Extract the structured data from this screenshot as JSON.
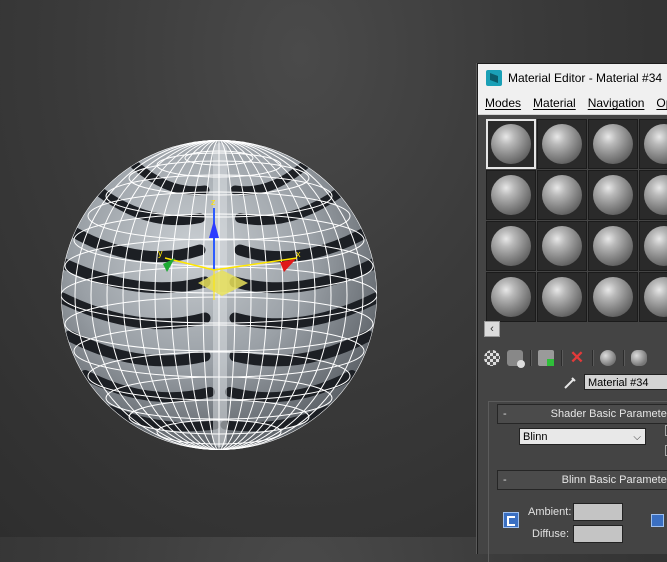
{
  "viewport": {
    "gizmo_axes": {
      "x_label": "x",
      "y_label": "y",
      "z_label": "z"
    }
  },
  "material_editor": {
    "title": "Material Editor - Material #34",
    "menu": [
      "Modes",
      "Material",
      "Navigation",
      "Options"
    ],
    "slots_visible": 16,
    "scroll_left_icon": "‹",
    "toolbar_icons": [
      "background-icon",
      "put-to-scene-icon",
      "assign-to-selection-icon",
      "delete-icon",
      "copy-material-icon",
      "make-unique-icon"
    ],
    "material_name": "Material #34",
    "shader_rollout": {
      "title": "Shader Basic Parameters",
      "shader": "Blinn"
    },
    "blinn_rollout": {
      "title": "Blinn Basic Parameters",
      "ambient_label": "Ambient:",
      "diffuse_label": "Diffuse:"
    }
  }
}
